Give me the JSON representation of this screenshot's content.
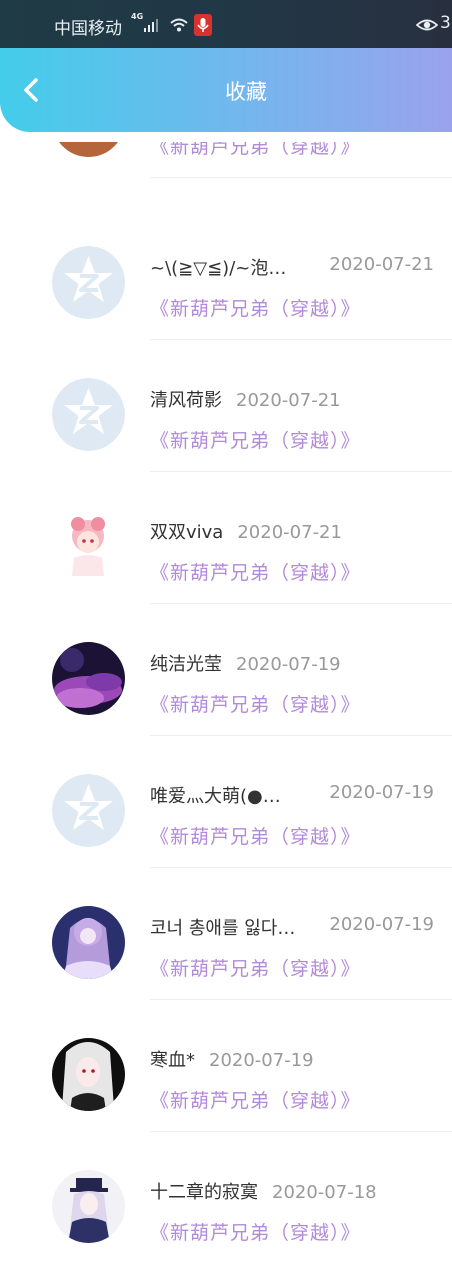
{
  "status_bar": {
    "carrier": "中国移动",
    "network": "4G",
    "battery_text": "3"
  },
  "header": {
    "title": "收藏"
  },
  "items": [
    {
      "name": "",
      "date": "",
      "link": "《新葫芦兄弟（穿越）》",
      "avatar": "desert-avatar"
    },
    {
      "name": "~\\(≧▽≦)/~泡…",
      "date": "2020-07-21",
      "link": "《新葫芦兄弟（穿越）》",
      "avatar": "default-avatar"
    },
    {
      "name": "清风荷影",
      "date": "2020-07-21",
      "link": "《新葫芦兄弟（穿越）》",
      "avatar": "default-avatar"
    },
    {
      "name": "双双viva",
      "date": "2020-07-21",
      "link": "《新葫芦兄弟（穿越）》",
      "avatar": "anime-girl-avatar"
    },
    {
      "name": "纯洁光莹",
      "date": "2020-07-19",
      "link": "《新葫芦兄弟（穿越）》",
      "avatar": "purple-cloud-avatar"
    },
    {
      "name": "唯爱灬大萌(●…",
      "date": "2020-07-19",
      "link": "《新葫芦兄弟（穿越）》",
      "avatar": "default-avatar"
    },
    {
      "name": "코너 총애를 잃다…",
      "date": "2020-07-19",
      "link": "《新葫芦兄弟（穿越）》",
      "avatar": "anime-night-avatar"
    },
    {
      "name": "寒血*",
      "date": "2020-07-19",
      "link": "《新葫芦兄弟（穿越）》",
      "avatar": "dark-anime-avatar"
    },
    {
      "name": "十二章的寂寞",
      "date": "2020-07-18",
      "link": "《新葫芦兄弟（穿越）》",
      "avatar": "hat-anime-avatar"
    }
  ],
  "colors": {
    "link": "#b28ad8",
    "header_start": "#43cdea",
    "header_end": "#9aa2ee"
  }
}
